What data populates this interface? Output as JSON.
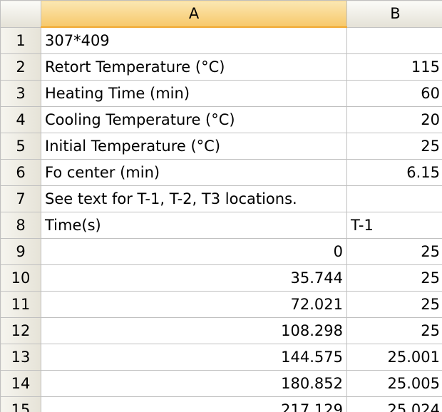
{
  "columns": [
    "A",
    "B"
  ],
  "rows": [
    {
      "num": "1",
      "a": "307*409",
      "b": ""
    },
    {
      "num": "2",
      "a": "Retort Temperature (°C)",
      "b": "115"
    },
    {
      "num": "3",
      "a": "Heating Time (min)",
      "b": "60"
    },
    {
      "num": "4",
      "a": "Cooling Temperature (°C)",
      "b": "20"
    },
    {
      "num": "5",
      "a": "Initial Temperature (°C)",
      "b": "25"
    },
    {
      "num": "6",
      "a": "Fo center (min)",
      "b": "6.15"
    },
    {
      "num": "7",
      "a": "See text for T-1, T-2, T3 locations.",
      "b": ""
    },
    {
      "num": "8",
      "a": "Time(s)",
      "b": "T-1"
    },
    {
      "num": "9",
      "a": "0",
      "b": "25"
    },
    {
      "num": "10",
      "a": "35.744",
      "b": "25"
    },
    {
      "num": "11",
      "a": "72.021",
      "b": "25"
    },
    {
      "num": "12",
      "a": "108.298",
      "b": "25"
    },
    {
      "num": "13",
      "a": "144.575",
      "b": "25.001"
    },
    {
      "num": "14",
      "a": "180.852",
      "b": "25.005"
    },
    {
      "num": "15",
      "a": "217.129",
      "b": "25.024"
    }
  ]
}
